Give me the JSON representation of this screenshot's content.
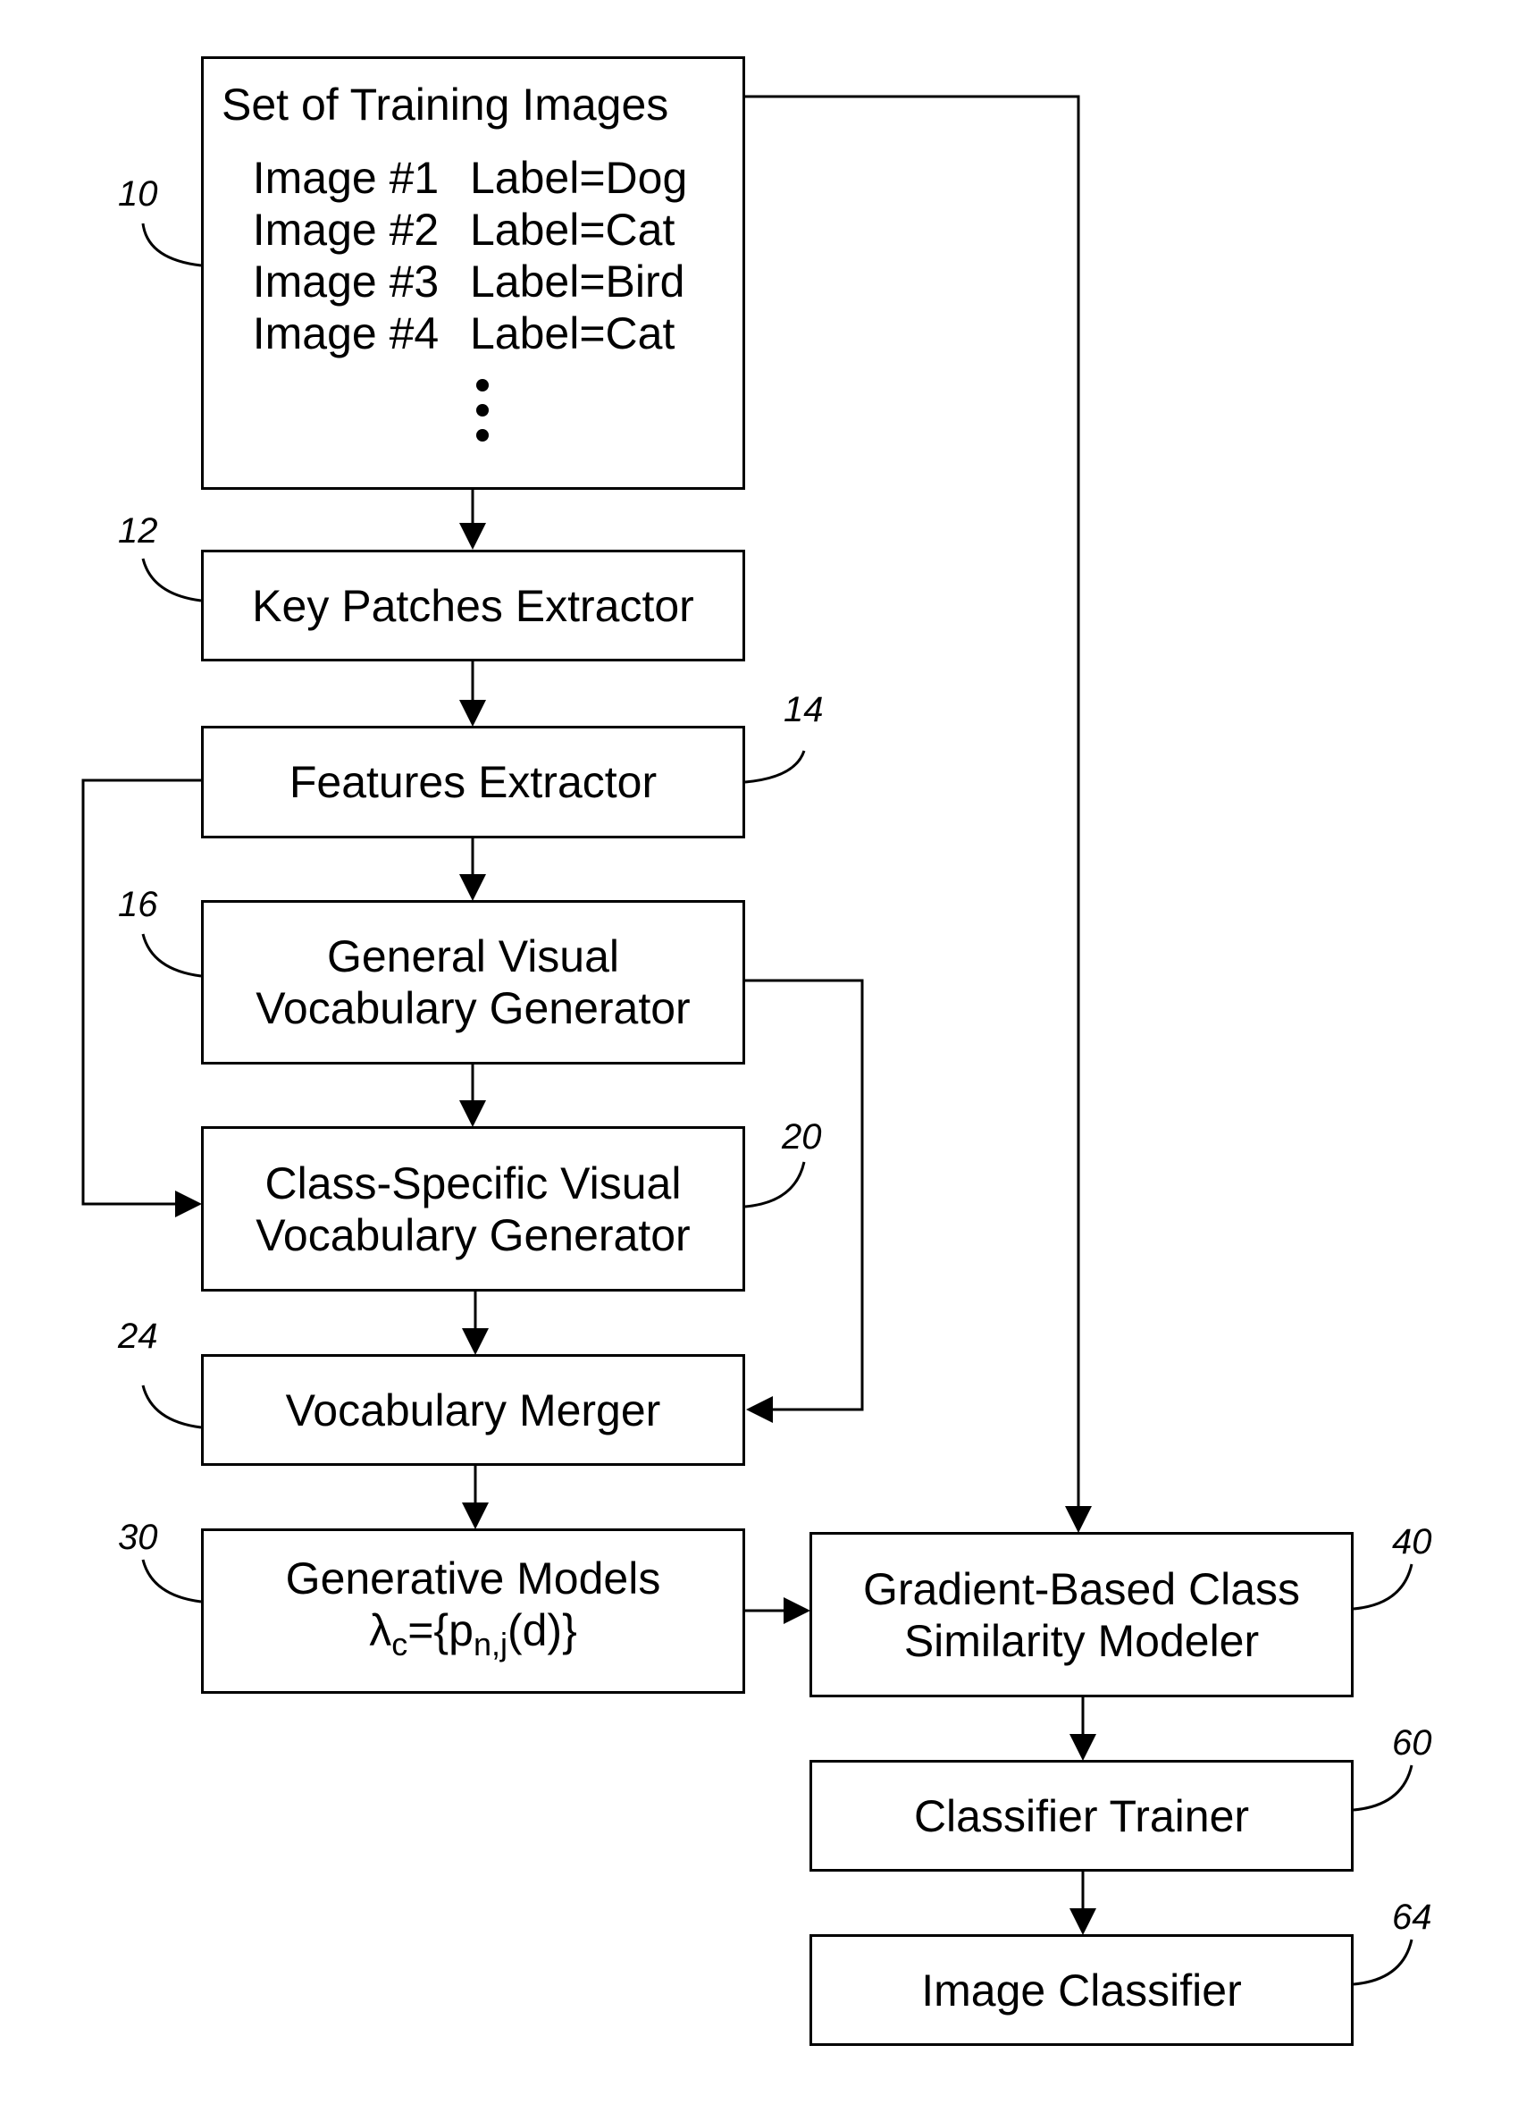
{
  "diagram": {
    "blocks": [
      {
        "id": "10",
        "title": "Set of Training Images",
        "items": [
          {
            "image": "Image #1",
            "label": "Label=Dog"
          },
          {
            "image": "Image #2",
            "label": "Label=Cat"
          },
          {
            "image": "Image #3",
            "label": "Label=Bird"
          },
          {
            "image": "Image #4",
            "label": "Label=Cat"
          }
        ]
      },
      {
        "id": "12",
        "lines": [
          "Key Patches Extractor"
        ]
      },
      {
        "id": "14",
        "lines": [
          "Features Extractor"
        ]
      },
      {
        "id": "16",
        "lines": [
          "General Visual",
          "Vocabulary Generator"
        ]
      },
      {
        "id": "20",
        "lines": [
          "Class-Specific Visual",
          "Vocabulary Generator"
        ]
      },
      {
        "id": "24",
        "lines": [
          "Vocabulary Merger"
        ]
      },
      {
        "id": "30",
        "lines": [
          "Generative Models"
        ],
        "formula": {
          "lhs": "λ",
          "lhs_sub": "c",
          "eq": "={p",
          "p_sub": "n,j",
          "rest": "(d)}"
        }
      },
      {
        "id": "40",
        "lines": [
          "Gradient-Based Class",
          "Similarity Modeler"
        ]
      },
      {
        "id": "60",
        "lines": [
          "Classifier Trainer"
        ]
      },
      {
        "id": "64",
        "lines": [
          "Image Classifier"
        ]
      }
    ]
  }
}
